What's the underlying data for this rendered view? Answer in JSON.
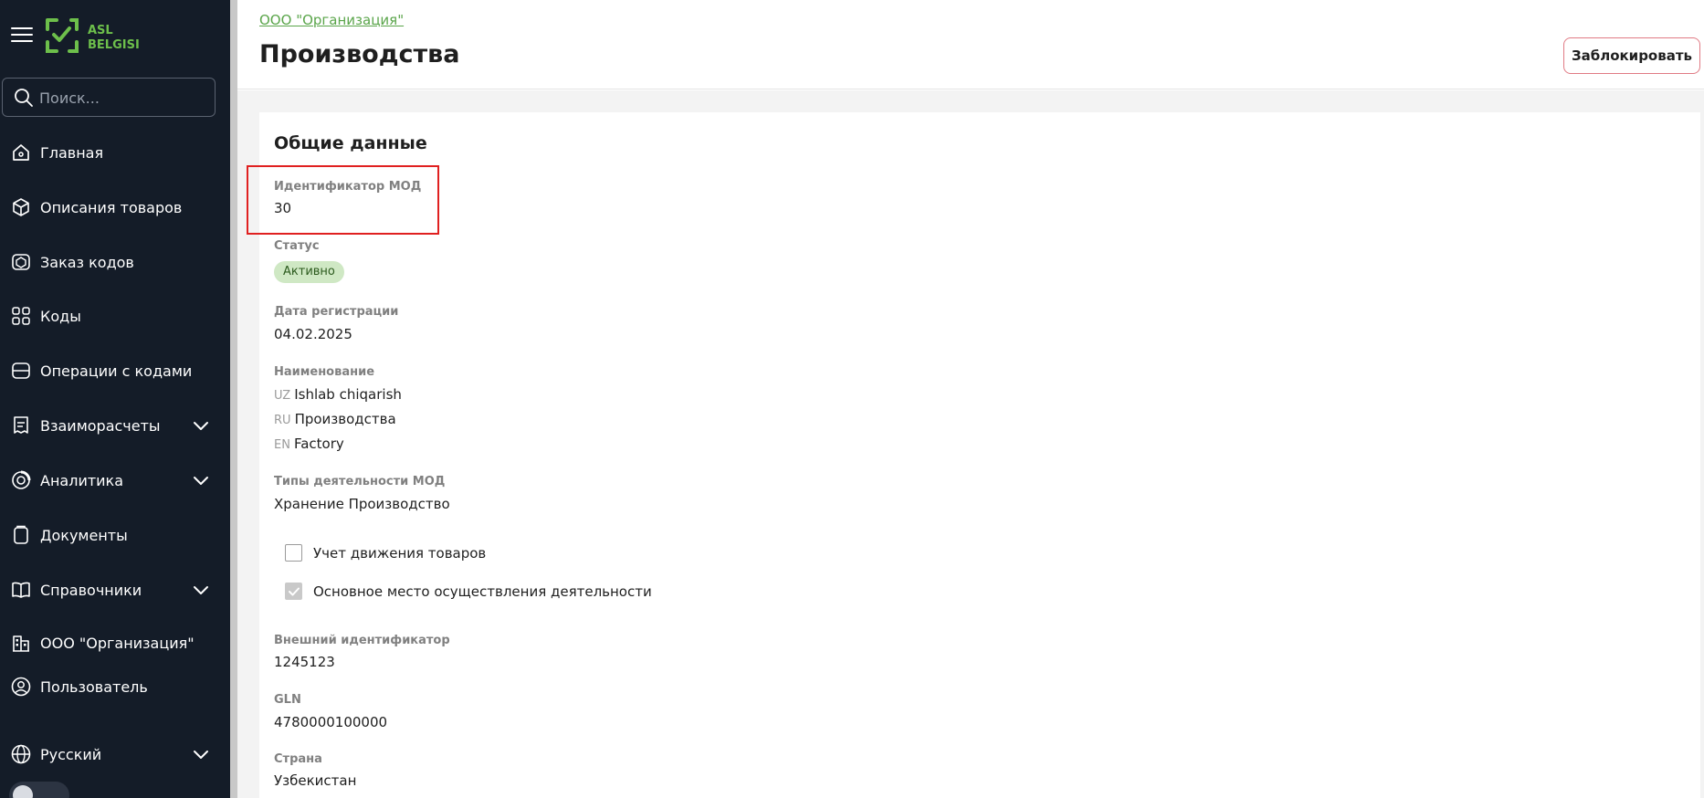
{
  "sidebar": {
    "search_placeholder": "Поиск...",
    "items": [
      {
        "label": "Главная",
        "icon": "home-icon"
      },
      {
        "label": "Описания товаров",
        "icon": "box-icon"
      },
      {
        "label": "Заказ кодов",
        "icon": "order-codes-icon"
      },
      {
        "label": "Коды",
        "icon": "codes-icon"
      },
      {
        "label": "Операции с кодами",
        "icon": "operations-icon"
      },
      {
        "label": "Взаиморасчеты",
        "icon": "receipt-icon"
      },
      {
        "label": "Аналитика",
        "icon": "analytics-icon"
      },
      {
        "label": "Документы",
        "icon": "documents-icon"
      },
      {
        "label": "Справочники",
        "icon": "book-icon"
      },
      {
        "label": "ООО \"Организация\"",
        "icon": "organization-icon"
      },
      {
        "label": "Пользователь",
        "icon": "user-icon"
      },
      {
        "label": "Русский",
        "icon": "globe-icon"
      }
    ]
  },
  "header": {
    "breadcrumb": "ООО \"Организация\"",
    "title": "Производства",
    "block_button": "Заблокировать"
  },
  "general": {
    "section_title": "Общие данные",
    "mod_id_label": "Идентификатор МОД",
    "mod_id_value": "30",
    "status_label": "Статус",
    "status_value": "Активно",
    "reg_date_label": "Дата регистрации",
    "reg_date_value": "04.02.2025",
    "name_label": "Наименование",
    "names": [
      {
        "lang": "UZ",
        "value": "Ishlab chiqarish"
      },
      {
        "lang": "RU",
        "value": "Производства"
      },
      {
        "lang": "EN",
        "value": "Factory"
      }
    ],
    "activity_types_label": "Типы деятельности МОД",
    "activity_types_value": "Хранение Производство",
    "checkbox_goods_movement": "Учет движения товаров",
    "checkbox_main_place": "Основное место осуществления деятельности",
    "external_id_label": "Внешний идентификатор",
    "external_id_value": "1245123",
    "gln_label": "GLN",
    "gln_value": "4780000100000",
    "country_label": "Страна",
    "country_value": "Узбекистан"
  },
  "colors": {
    "sidebar_bg": "#141c28",
    "accent_green": "#5aa54a",
    "highlight_red": "#e02020",
    "block_button_border": "#e07a84",
    "status_badge_bg": "#cfe8c4"
  }
}
